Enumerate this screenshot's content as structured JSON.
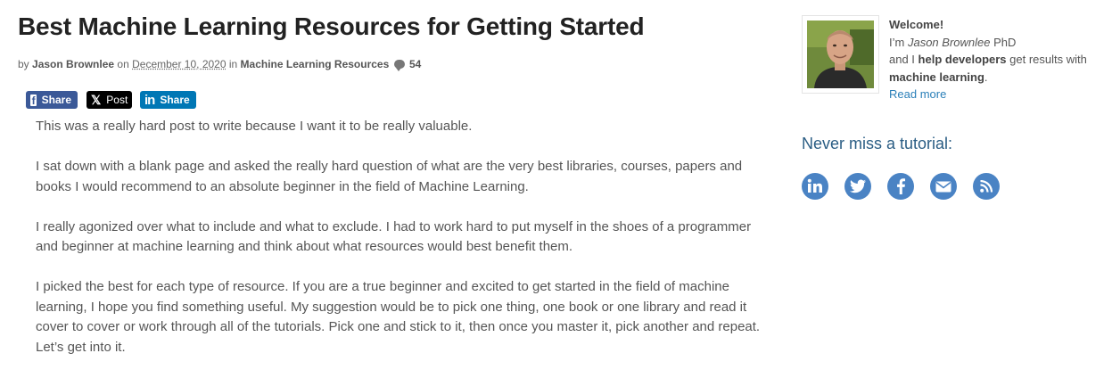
{
  "article": {
    "title": "Best Machine Learning Resources for Getting Started",
    "byline": {
      "by": "by",
      "author": "Jason Brownlee",
      "on": "on",
      "date": "December 10, 2020",
      "in": "in",
      "category": "Machine Learning Resources",
      "comment_count": "54"
    },
    "share": {
      "facebook_label": "Share",
      "x_label": "Post",
      "linkedin_label": "Share"
    },
    "paragraphs": [
      "This was a really hard post to write because I want it to be really valuable.",
      "I sat down with a blank page and asked the really hard question of what are the very best libraries, courses, papers and books I would recommend to an absolute beginner in the field of Machine Learning.",
      "I really agonized over what to include and what to exclude. I had to work hard to put myself in the shoes of a programmer and beginner at machine learning and think about what resources would best benefit them.",
      "I picked the best for each type of resource. If you are a true beginner and excited to get started in the field of machine learning, I hope you find something useful. My suggestion would be to pick one thing, one book or one library and read it cover to cover or work through all of the tutorials. Pick one and stick to it, then once you master it, pick another and repeat. Let’s get into it."
    ]
  },
  "sidebar": {
    "welcome": {
      "heading": "Welcome!",
      "im": "I’m",
      "name": "Jason Brownlee",
      "suffix": "PhD",
      "and_i": "and I",
      "help": "help developers",
      "get_results": "get results with",
      "ml": "machine learning",
      "period": ".",
      "read_more": "Read more"
    },
    "never_miss": "Never miss a tutorial:",
    "social_icons": [
      "linkedin-icon",
      "twitter-icon",
      "facebook-icon",
      "email-icon",
      "rss-icon"
    ]
  },
  "colors": {
    "title": "#222222",
    "body_text": "#555555",
    "facebook": "#3b5998",
    "x": "#000000",
    "linkedin": "#0077b5",
    "link": "#2a7fb8",
    "heading_blue": "#2a5d84",
    "social_circle": "#4a83c4"
  }
}
